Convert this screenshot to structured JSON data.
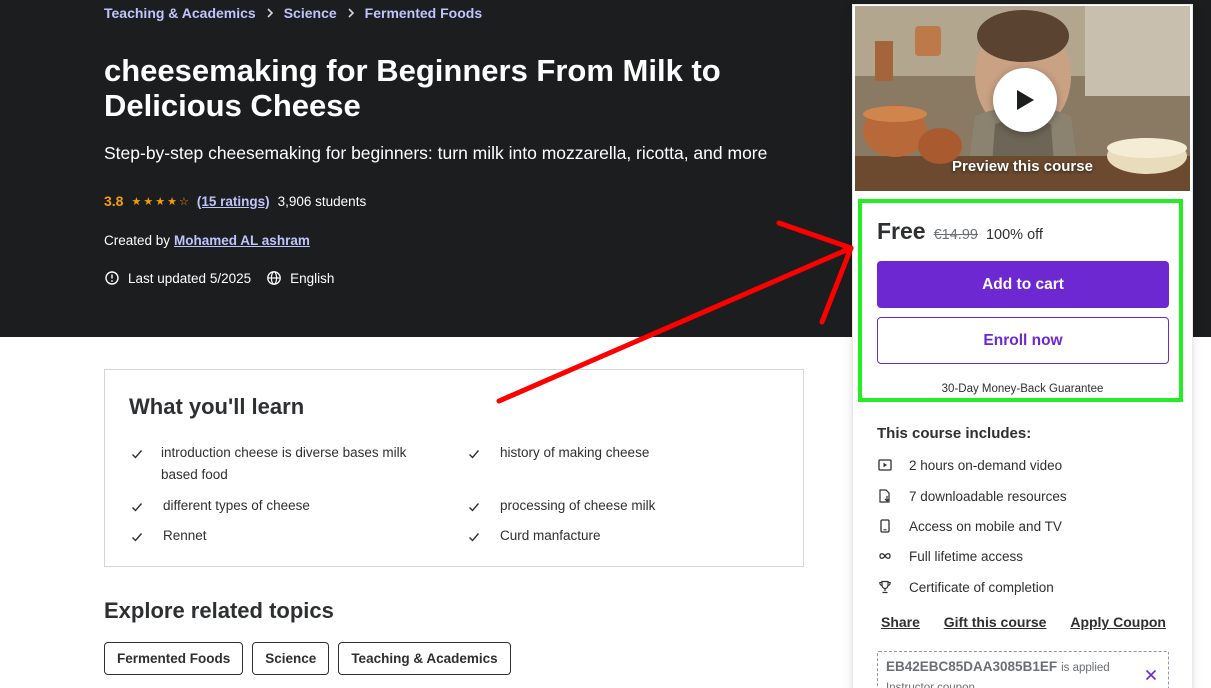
{
  "breadcrumb": [
    "Teaching & Academics",
    "Science",
    "Fermented Foods"
  ],
  "course": {
    "title": "cheesemaking for Beginners From Milk to Delicious Cheese",
    "subtitle": "Step-by-step cheesemaking for beginners: turn milk into mozzarella, ricotta, and more",
    "rating": "3.8",
    "stars_value": 3.8,
    "ratings_link": "(15 ratings)",
    "students": "3,906 students",
    "created_by_label": "Created by",
    "instructor": "Mohamed AL ashram",
    "last_updated": "Last updated 5/2025",
    "language": "English"
  },
  "learn": {
    "title": "What you'll learn",
    "items": [
      "introduction cheese is diverse bases milk based food",
      "history of making cheese",
      "different types of cheese",
      "processing of cheese milk",
      "Rennet",
      "Curd manfacture"
    ]
  },
  "explore": {
    "title": "Explore related topics",
    "topics": [
      "Fermented Foods",
      "Science",
      "Teaching & Academics"
    ]
  },
  "sidebar": {
    "preview_label": "Preview this course",
    "price": "Free",
    "original_price": "€14.99",
    "discount": "100% off",
    "add_to_cart": "Add to cart",
    "enroll_now": "Enroll now",
    "guarantee": "30-Day Money-Back Guarantee",
    "includes_title": "This course includes:",
    "includes": [
      {
        "icon": "video-icon",
        "text": "2 hours on-demand video"
      },
      {
        "icon": "file-download-icon",
        "text": "7 downloadable resources"
      },
      {
        "icon": "mobile-icon",
        "text": "Access on mobile and TV"
      },
      {
        "icon": "infinity-icon",
        "text": "Full lifetime access"
      },
      {
        "icon": "trophy-icon",
        "text": "Certificate of completion"
      }
    ],
    "share": "Share",
    "gift": "Gift this course",
    "apply_coupon": "Apply Coupon",
    "coupon_code": "EB42EBC85DAA3085B1EF",
    "coupon_applied": "is applied",
    "coupon_type": "Instructor coupon"
  },
  "colors": {
    "hero_bg": "#1c1d1f",
    "accent_purple": "#6d28d2",
    "link_lavender": "#c0c4fc",
    "star_orange": "#f69c08",
    "highlight_green": "#22ee22",
    "arrow_red": "#ff0000"
  }
}
